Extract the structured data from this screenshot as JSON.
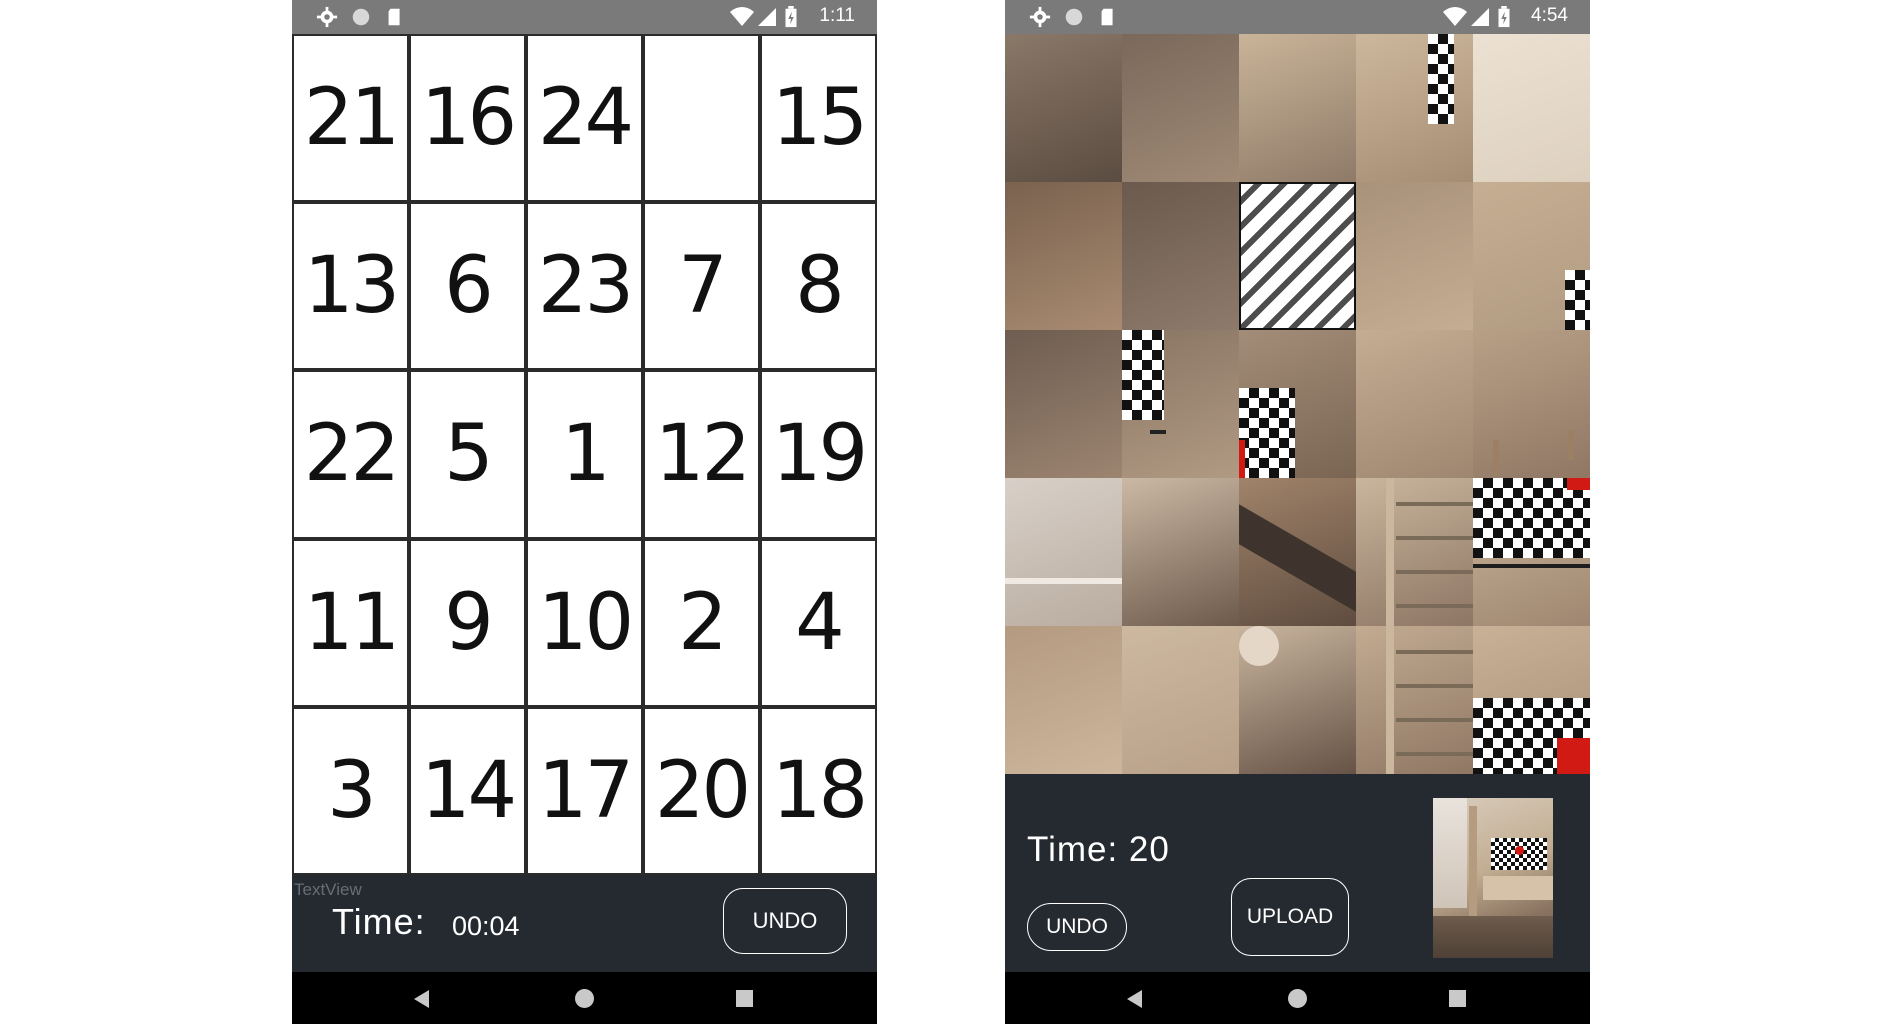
{
  "left_phone": {
    "status": {
      "time": "1:11"
    },
    "board": {
      "tiles": [
        "21",
        "16",
        "24",
        "",
        "15",
        "13",
        "6",
        "23",
        "7",
        "8",
        "22",
        "5",
        "1",
        "12",
        "19",
        "11",
        "9",
        "10",
        "2",
        "4",
        "3",
        "14",
        "17",
        "20",
        "18"
      ]
    },
    "textview_label": "TextView",
    "time_label": "Time:",
    "time_value": "00:04",
    "undo_label": "UNDO"
  },
  "right_phone": {
    "status": {
      "time": "4:54"
    },
    "board": {
      "tiles": [
        {
          "c1": "#8a7868",
          "c2": "#5b4c41",
          "kind": "floor"
        },
        {
          "c1": "#7a685a",
          "c2": "#a08a76",
          "kind": "floor"
        },
        {
          "c1": "#c9b499",
          "c2": "#8f7a68",
          "kind": "room"
        },
        {
          "c1": "#cdb79c",
          "c2": "#a58d74",
          "kind": "tv-corner"
        },
        {
          "c1": "#ece1d2",
          "c2": "#ddd0bf",
          "kind": "wall"
        },
        {
          "c1": "#7a624f",
          "c2": "#a88b71",
          "kind": "wood"
        },
        {
          "c1": "#6b5a4d",
          "c2": "#8d7a6b",
          "kind": "floor"
        },
        {
          "c1": "#ffffff",
          "c2": "#ffffff",
          "kind": "blank"
        },
        {
          "c1": "#a9927a",
          "c2": "#c4ad93",
          "kind": "wood"
        },
        {
          "c1": "#c6ae92",
          "c2": "#b19b82",
          "kind": "tv-edge"
        },
        {
          "c1": "#6e5d51",
          "c2": "#9c8470",
          "kind": "floor"
        },
        {
          "c1": "#8a7564",
          "c2": "#b09a83",
          "kind": "tv-left"
        },
        {
          "c1": "#a38d78",
          "c2": "#7a6553",
          "kind": "tv-mid"
        },
        {
          "c1": "#c5ad94",
          "c2": "#9e8670",
          "kind": "cabinet"
        },
        {
          "c1": "#b8a087",
          "c2": "#8f7764",
          "kind": "cabinet-leg"
        },
        {
          "c1": "#d8d0c8",
          "c2": "#b9aca0",
          "kind": "window"
        },
        {
          "c1": "#cbb9a5",
          "c2": "#6d5a4b",
          "kind": "floor-light"
        },
        {
          "c1": "#a0836a",
          "c2": "#5f4c3f",
          "kind": "rug"
        },
        {
          "c1": "#c9b59d",
          "c2": "#8d7664",
          "kind": "shelf"
        },
        {
          "c1": "#cdb79c",
          "c2": "#9e8670",
          "kind": "tv-main"
        },
        {
          "c1": "#b39a80",
          "c2": "#cdb69c",
          "kind": "wood"
        },
        {
          "c1": "#cdb8a0",
          "c2": "#b9a189",
          "kind": "wood"
        },
        {
          "c1": "#c9b59e",
          "c2": "#665346",
          "kind": "cat"
        },
        {
          "c1": "#c2ab91",
          "c2": "#8f7764",
          "kind": "shelf-low"
        },
        {
          "c1": "#c8b197",
          "c2": "#a89077",
          "kind": "tv-bottom"
        }
      ]
    },
    "time_label": "Time: 20",
    "undo_label": "UNDO",
    "upload_label": "UPLOAD",
    "thumbnail": "room-preview-thumbnail"
  },
  "colors": {
    "status_bar": "#7a7a7a",
    "bottom_panel": "#252a31",
    "nav_bar": "#000000"
  }
}
